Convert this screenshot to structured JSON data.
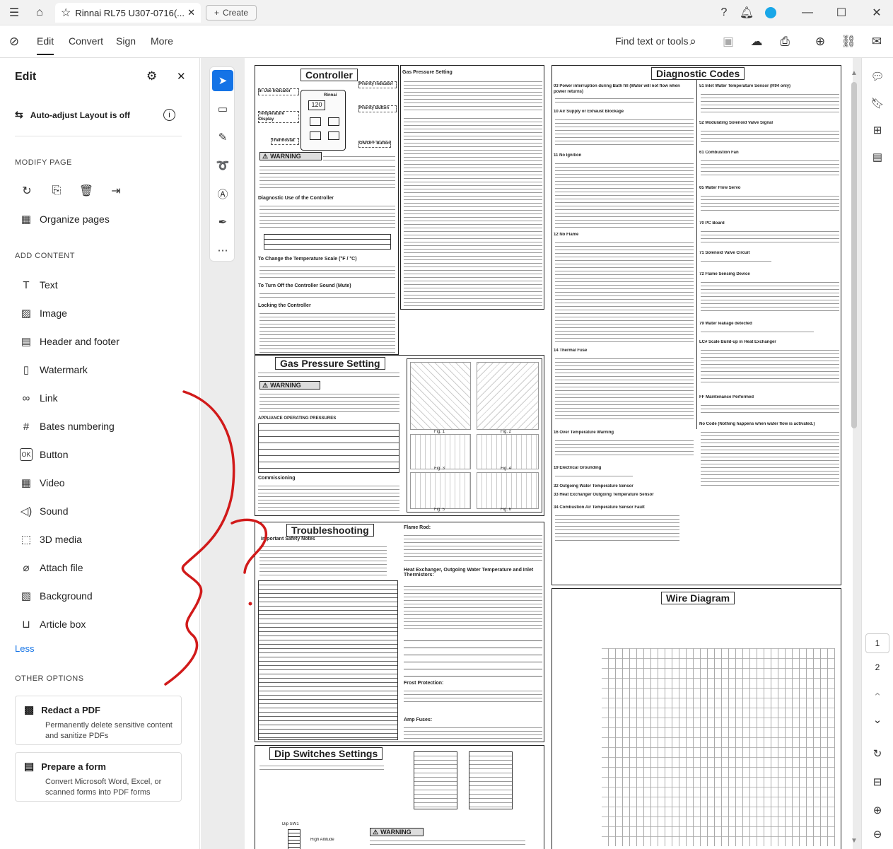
{
  "titlebar": {
    "tab_title": "Rinnai RL75 U307-0716(...",
    "create_label": "Create"
  },
  "menubar": {
    "items": [
      "Edit",
      "Convert",
      "Sign",
      "More"
    ],
    "find_text": "Find text or tools"
  },
  "panel": {
    "title": "Edit",
    "auto_adjust": "Auto-adjust Layout is off",
    "modify_heading": "MODIFY PAGE",
    "organize": "Organize pages",
    "add_heading": "ADD CONTENT",
    "add_items": [
      "Text",
      "Image",
      "Header and footer",
      "Watermark",
      "Link",
      "Bates numbering",
      "Button",
      "Video",
      "Sound",
      "3D media",
      "Attach file",
      "Background",
      "Article box"
    ],
    "less": "Less",
    "other_heading": "OTHER OPTIONS",
    "cards": [
      {
        "title": "Redact a PDF",
        "desc": "Permanently delete sensitive content and sanitize PDFs"
      },
      {
        "title": "Prepare a form",
        "desc": "Convert Microsoft Word, Excel, or scanned forms into PDF forms"
      }
    ]
  },
  "document": {
    "headings": {
      "controller": "Controller",
      "gas_pressure_setting": "Gas Pressure Setting",
      "gas_pressure_box": "Gas Pressure Setting",
      "troubleshooting": "Troubleshooting",
      "dip_switches": "Dip Switches Settings",
      "diagnostic_codes": "Diagnostic Codes",
      "wire_diagram": "Wire Diagram",
      "warning": "WARNING"
    },
    "controller_labels": {
      "in_use": "In Use Indicator",
      "temp_display": "Temperature Display",
      "thermostat": "Thermostat",
      "priority": "Priority Indicator",
      "priority_button": "Priority Button",
      "onoff": "ON/OFF Button",
      "display_value": "120",
      "brand": "Rinnai"
    },
    "subheads": {
      "diag_use": "Diagnostic Use of the Controller",
      "change_scale": "To Change the Temperature Scale (°F / °C)",
      "turn_off_sound": "To Turn Off the Controller Sound (Mute)",
      "locking": "Locking the Controller",
      "commissioning": "Commissioning",
      "appliance_pressures": "APPLIANCE OPERATING PRESSURES",
      "safety_notes": "Important Safety Notes",
      "flame_rod": "Flame Rod:",
      "heat_exchanger": "Heat Exchanger, Outgoing Water Temperature and Inlet Thermistors:",
      "frost": "Frost Protection:",
      "amp_fuses": "Amp Fuses:",
      "dip_sw1": "Dip SW1",
      "high_altitude": "High Altitude"
    },
    "figures": [
      "Fig. 1",
      "Fig. 2",
      "Fig. 3",
      "Fig. 4",
      "Fig. 5",
      "Fig. 6"
    ],
    "diag_codes_left": [
      "03 Power interruption during Bath fill (Water will not flow when power returns)",
      "10 Air Supply or Exhaust Blockage",
      "11 No Ignition",
      "12 No Flame",
      "14 Thermal Fuse",
      "16 Over Temperature Warning",
      "19 Electrical Grounding",
      "32 Outgoing Water Temperature Sensor",
      "33 Heat Exchanger Outgoing Temperature Sensor",
      "34 Combustion Air Temperature Sensor Fault"
    ],
    "diag_codes_right": [
      "51 Inlet Water Temperature Sensor (R94 only)",
      "52 Modulating Solenoid Valve Signal",
      "61 Combustion Fan",
      "65 Water Flow Servo",
      "70 PC Board",
      "71 Solenoid Valve Circuit",
      "72 Flame Sensing Device",
      "79 Water leakage detected",
      "LC# Scale Build-up in Heat Exchanger",
      "FF Maintenance Performed",
      "No Code (Nothing happens when water flow is activated.)"
    ]
  },
  "pagination": {
    "pages": [
      "1",
      "2"
    ]
  },
  "colors": {
    "accent": "#1473e6",
    "annotation": "#d11a1a",
    "panel_bg": "#ffffff",
    "doc_bg": "#ececec"
  }
}
